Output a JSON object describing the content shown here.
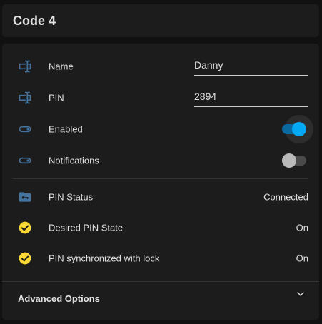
{
  "header": {
    "title": "Code 4"
  },
  "fields": {
    "name": {
      "label": "Name",
      "value": "Danny",
      "icon": "textbox-icon"
    },
    "pin": {
      "label": "PIN",
      "value": "2894",
      "icon": "textbox-icon"
    }
  },
  "toggles": {
    "enabled": {
      "label": "Enabled",
      "state": true
    },
    "notifications": {
      "label": "Notifications",
      "state": false
    }
  },
  "status": {
    "pin_status": {
      "label": "PIN Status",
      "value": "Connected",
      "icon": "folder-key-icon"
    },
    "desired_state": {
      "label": "Desired PIN State",
      "value": "On",
      "icon": "check-circle-icon"
    },
    "synchronized": {
      "label": "PIN synchronized with lock",
      "value": "On",
      "icon": "check-circle-icon"
    }
  },
  "advanced": {
    "label": "Advanced Options"
  },
  "colors": {
    "accent": "#03a9f4",
    "icon_blue": "#44739e",
    "check_yellow": "#fdd835",
    "card_bg": "#1c1c1c",
    "page_bg": "#111111"
  }
}
